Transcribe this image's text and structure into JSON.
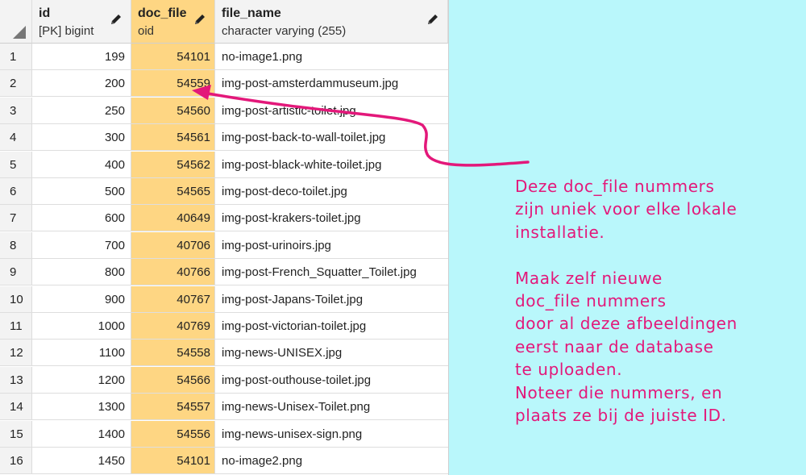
{
  "table": {
    "columns": [
      {
        "name": "id",
        "type": "[PK] bigint"
      },
      {
        "name": "doc_file",
        "type": "oid"
      },
      {
        "name": "file_name",
        "type": "character varying (255)"
      }
    ],
    "rows": [
      {
        "n": "1",
        "id": "199",
        "doc_file": "54101",
        "file_name": "no-image1.png"
      },
      {
        "n": "2",
        "id": "200",
        "doc_file": "54559",
        "file_name": "img-post-amsterdammuseum.jpg"
      },
      {
        "n": "3",
        "id": "250",
        "doc_file": "54560",
        "file_name": "img-post-artistic-toilet.jpg"
      },
      {
        "n": "4",
        "id": "300",
        "doc_file": "54561",
        "file_name": "img-post-back-to-wall-toilet.jpg"
      },
      {
        "n": "5",
        "id": "400",
        "doc_file": "54562",
        "file_name": "img-post-black-white-toilet.jpg"
      },
      {
        "n": "6",
        "id": "500",
        "doc_file": "54565",
        "file_name": "img-post-deco-toilet.jpg"
      },
      {
        "n": "7",
        "id": "600",
        "doc_file": "40649",
        "file_name": "img-post-krakers-toilet.jpg"
      },
      {
        "n": "8",
        "id": "700",
        "doc_file": "40706",
        "file_name": "img-post-urinoirs.jpg"
      },
      {
        "n": "9",
        "id": "800",
        "doc_file": "40766",
        "file_name": "img-post-French_Squatter_Toilet.jpg"
      },
      {
        "n": "10",
        "id": "900",
        "doc_file": "40767",
        "file_name": "img-post-Japans-Toilet.jpg"
      },
      {
        "n": "11",
        "id": "1000",
        "doc_file": "40769",
        "file_name": "img-post-victorian-toilet.jpg"
      },
      {
        "n": "12",
        "id": "1100",
        "doc_file": "54558",
        "file_name": "img-news-UNISEX.jpg"
      },
      {
        "n": "13",
        "id": "1200",
        "doc_file": "54566",
        "file_name": "img-post-outhouse-toilet.jpg"
      },
      {
        "n": "14",
        "id": "1300",
        "doc_file": "54557",
        "file_name": "img-news-Unisex-Toilet.png"
      },
      {
        "n": "15",
        "id": "1400",
        "doc_file": "54556",
        "file_name": "img-news-unisex-sign.png"
      },
      {
        "n": "16",
        "id": "1450",
        "doc_file": "54101",
        "file_name": "no-image2.png"
      }
    ]
  },
  "annotation": {
    "lines": [
      "Deze doc_file nummers",
      "zijn uniek voor elke lokale",
      "installatie.",
      "",
      "Maak zelf nieuwe",
      "doc_file nummers",
      "door al deze afbeeldingen",
      "eerst naar de database",
      "te uploaden.",
      "Noteer die nummers, en",
      "plaats ze bij de juiste ID."
    ],
    "color": "#e3187a"
  },
  "colors": {
    "highlight": "#fed683",
    "background": "#b9f7fb"
  },
  "icons": {
    "edit": "pencil-icon",
    "corner": "sort-corner-icon"
  }
}
